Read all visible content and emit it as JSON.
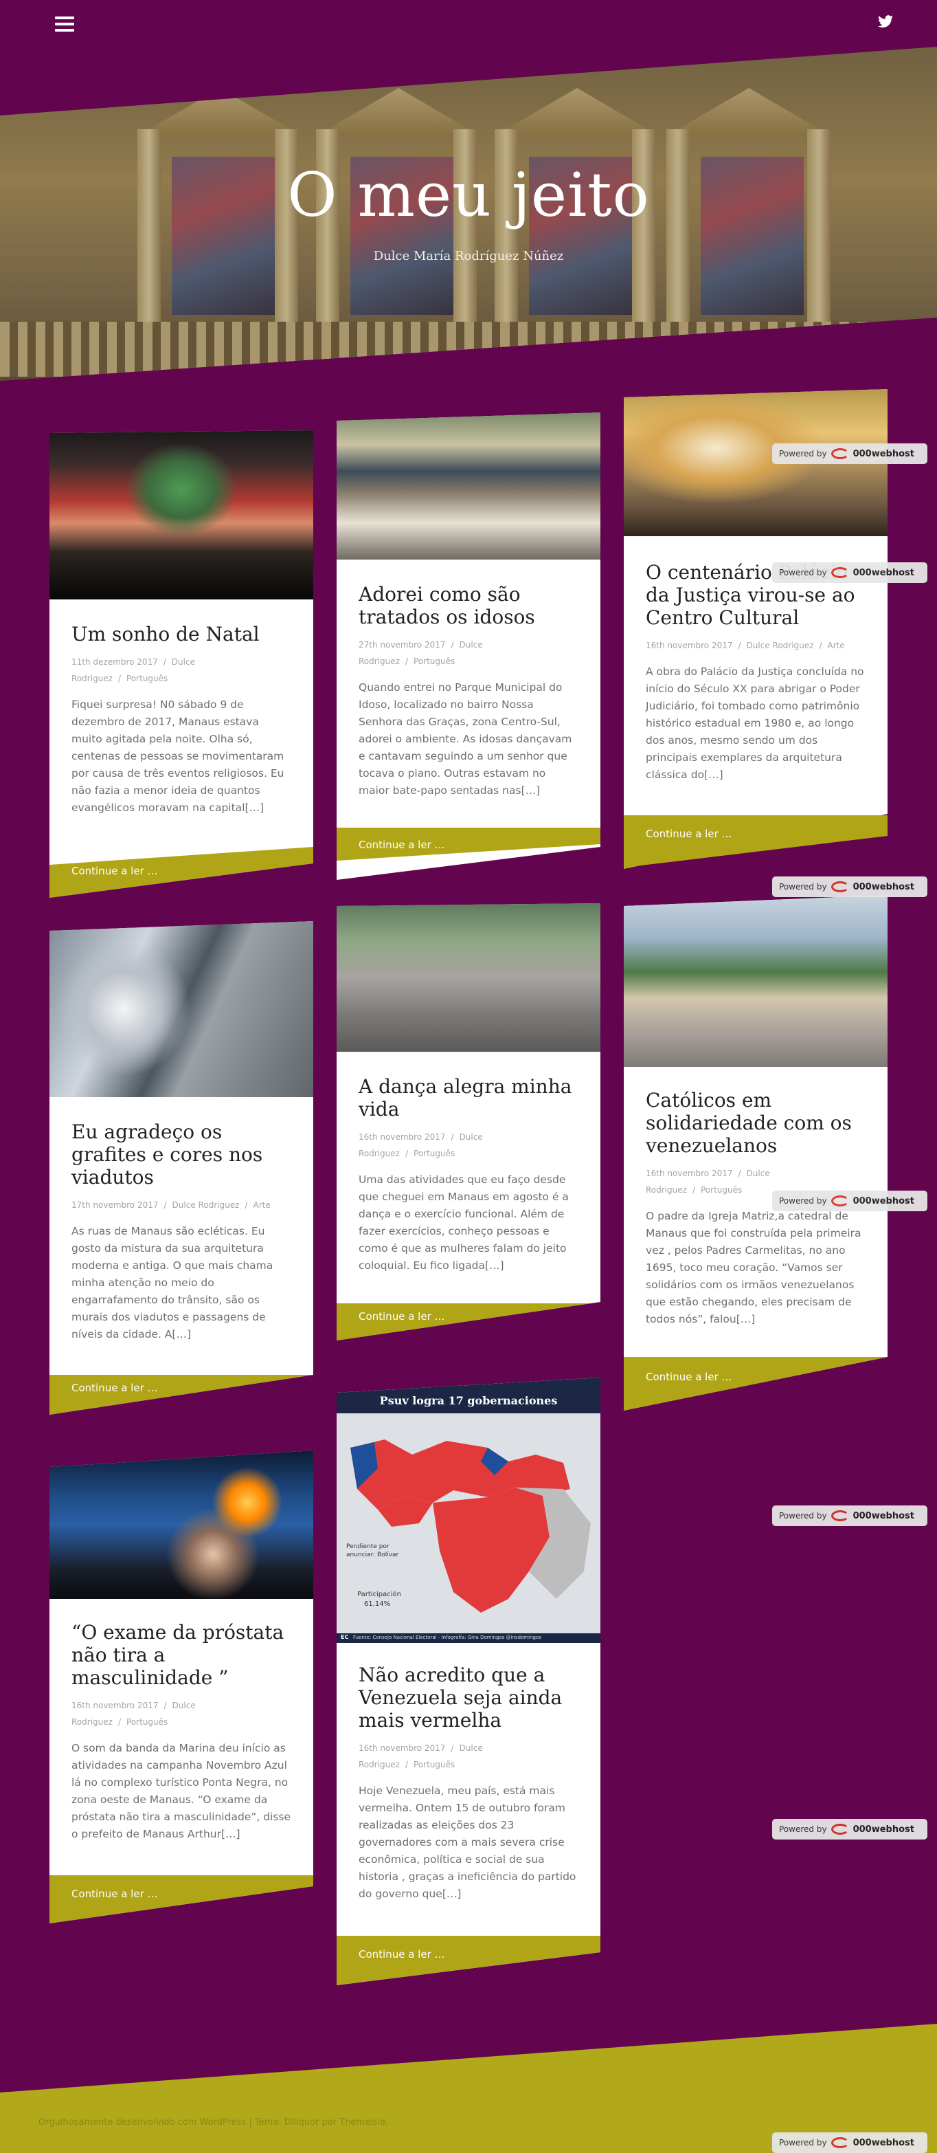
{
  "topbar": {
    "menu_icon": "hamburger-menu-icon",
    "social_icon": "twitter-icon"
  },
  "hero": {
    "title": "O meu jeito",
    "description": "Dulce María Rodríguez Núñez"
  },
  "posts": [
    {
      "title": "Um sonho de Natal",
      "date": "11th dezembro 2017",
      "author": "Dulce Rodriguez",
      "category": "Português",
      "excerpt": "Fiquei surpresa! N0 sábado 9 de dezembro de 2017, Manaus estava muito agitada pela noite.  Olha só, centenas de pessoas se movimentaram por causa de três eventos religiosos. Eu não fazia a menor ideia de quantos evangélicos moravam na capital[…]",
      "more": "Continue a ler …"
    },
    {
      "title": "Adorei como são tratados os idosos",
      "date": "27th novembro 2017",
      "author": "Dulce Rodriguez",
      "category": "Português",
      "excerpt": "  Quando entrei no Parque Municipal do Idoso, localizado no bairro  Nossa Senhora das Graças, zona Centro-Sul, adorei o ambiente. As idosas dançavam e cantavam seguindo a um senhor que tocava o piano. Outras estavam no maior bate-papo sentadas nas[…]",
      "more": "Continue a ler …"
    },
    {
      "title": "O centenário Palácio da Justiça virou-se ao Centro Cultural",
      "date": "16th novembro 2017",
      "author": "Dulce Rodriguez",
      "category": "Arte",
      "excerpt": "A obra do Palácio da Justiça concluída no início do Século XX para abrigar o Poder Judiciário, foi tombado como patrimônio histórico estadual em 1980 e, ao longo dos anos, mesmo sendo um dos principais exemplares da arquitetura clássica do[…]",
      "more": "Continue a ler …"
    },
    {
      "title": "Eu agradeço os grafites e cores nos viadutos",
      "date": "17th novembro 2017",
      "author": "Dulce Rodriguez",
      "category": "Arte",
      "excerpt": "As ruas de Manaus são ecléticas. Eu gosto da mistura da sua arquitetura moderna e antiga. O que mais chama minha atenção no meio do engarrafamento do trânsito, são os murais dos viadutos e passagens de níveis  da cidade. A[…]",
      "more": "Continue a ler …"
    },
    {
      "title": "A dança alegra minha vida",
      "date": "16th novembro 2017",
      "author": "Dulce Rodriguez",
      "category": "Português",
      "excerpt": "  Uma das atividades que eu faço desde que cheguei em Manaus em agosto é a dança e o exercício  funcional. Além de fazer exercícios, conheço pessoas e como é que as mulheres falam do jeito coloquial. Eu fico ligada[…]",
      "more": "Continue a ler …"
    },
    {
      "title": "Católicos em solidariedade com os venezuelanos",
      "date": "16th novembro 2017",
      "author": "Dulce Rodriguez",
      "category": "Português",
      "excerpt": "O padre da Igreja Matriz,a catedral de Manaus que foi construída pela primeira vez , pelos Padres Carmelitas, no ano 1695, toco meu coração. “Vamos ser solidários com os irmãos venezuelanos que estão chegando, eles precisam de todos nós”, falou[…]",
      "more": "Continue a ler …"
    },
    {
      "title": "“O exame da próstata não tira a masculinidade ”",
      "date": "16th novembro 2017",
      "author": "Dulce Rodriguez",
      "category": "Português",
      "excerpt": "  O som da banda da Marina deu início as atividades na campanha Novembro Azul lá no complexo turístico  Ponta Negra, no zona oeste de Manaus.  “O exame da próstata não tira a masculinidade”, disse o prefeito de Manaus Arthur[…]",
      "more": "Continue a ler …"
    },
    {
      "title": "Não acredito que a Venezuela seja ainda mais vermelha",
      "date": "16th novembro 2017",
      "author": "Dulce Rodriguez",
      "category": "Português",
      "excerpt": "  Hoje Venezuela, meu país,  está mais vermelha.  Ontem 15 de outubro foram realizadas as eleições dos 23 governadores com a mais severa crise econômica,  política e social de sua historia , graças a ineficiência do partido do governo que[…]",
      "more": "Continue a ler …",
      "image": {
        "header": "Psuv logra 17 gobernaciones",
        "note1": "Pendiente por anunciar: Bolívar",
        "note2_label": "Participación",
        "note2_value": "61,14%",
        "source": "Fuente: Consejo Nacional Electoral - Infografía: Gina Domingos @insdomingos",
        "logo": "EC"
      }
    }
  ],
  "badge": {
    "powered": "Powered by",
    "brand": "000webhost"
  },
  "footer": {
    "text": "Orgulhosamente desenvolvido com WordPress  |  Tema: Dlliquor por Themeisle."
  }
}
